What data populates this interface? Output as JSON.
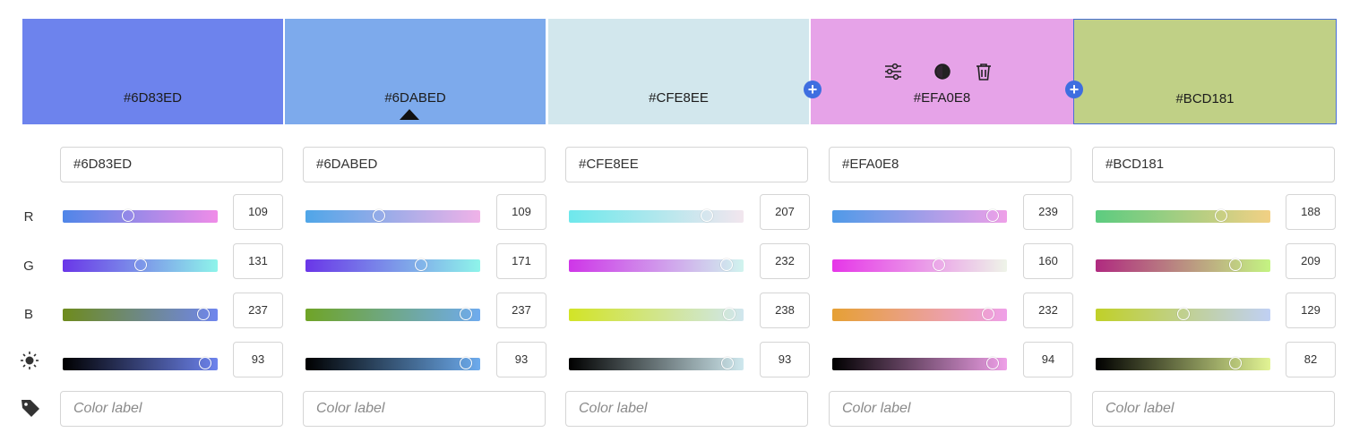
{
  "swatches": [
    {
      "hex": "#6D83ED",
      "color": "#6D83ED"
    },
    {
      "hex": "#6DABED",
      "color": "#7DAAEC"
    },
    {
      "hex": "#CFE8EE",
      "color": "#D2E7ED"
    },
    {
      "hex": "#EFA0E8",
      "color": "#E6A3E8"
    },
    {
      "hex": "#BCD181",
      "color": "#C0D086"
    }
  ],
  "selected_swatch": 4,
  "row_labels": {
    "r": "R",
    "g": "G",
    "b": "B"
  },
  "icons": {
    "add": "add-plus-icon",
    "adjust": "sliders-adjust-icon",
    "contrast": "contrast-icon",
    "delete": "trash-icon",
    "brightness": "brightness-sun-icon",
    "label": "tag-icon"
  },
  "columns": [
    {
      "hex_value": "#6D83ED",
      "label_placeholder": "Color label",
      "r": "109",
      "g": "131",
      "b": "237",
      "bright": "93",
      "r_pos": 0.42,
      "g_pos": 0.5,
      "b_pos": 0.91,
      "br_pos": 0.92,
      "r_grad": [
        "#4f86e8",
        "#f08ce8"
      ],
      "g_grad": [
        "#6a36e8",
        "#8ef4ea"
      ],
      "b_grad": [
        "#6e8b1c",
        "#6f86ee"
      ],
      "br_grad": [
        "#000000",
        "#6d83ed"
      ]
    },
    {
      "hex_value": "#6DABED",
      "label_placeholder": "Color label",
      "r": "109",
      "g": "171",
      "b": "237",
      "bright": "93",
      "r_pos": 0.42,
      "g_pos": 0.66,
      "b_pos": 0.92,
      "br_pos": 0.92,
      "r_grad": [
        "#4fa6e8",
        "#f0b2e8"
      ],
      "g_grad": [
        "#6a36e8",
        "#8ef4ea"
      ],
      "b_grad": [
        "#6fa426",
        "#6fabee"
      ],
      "br_grad": [
        "#000000",
        "#6dabed"
      ]
    },
    {
      "hex_value": "#CFE8EE",
      "label_placeholder": "Color label",
      "r": "207",
      "g": "232",
      "b": "238",
      "bright": "93",
      "r_pos": 0.79,
      "g_pos": 0.9,
      "b_pos": 0.92,
      "br_pos": 0.91,
      "r_grad": [
        "#6ee8ec",
        "#f2e6ee"
      ],
      "g_grad": [
        "#cf36e8",
        "#d0f4ee"
      ],
      "b_grad": [
        "#d2e426",
        "#d0e6ee"
      ],
      "br_grad": [
        "#000000",
        "#cfe8ee"
      ]
    },
    {
      "hex_value": "#EFA0E8",
      "label_placeholder": "Color label",
      "r": "239",
      "g": "160",
      "b": "232",
      "bright": "94",
      "r_pos": 0.92,
      "g_pos": 0.61,
      "b_pos": 0.89,
      "br_pos": 0.92,
      "r_grad": [
        "#4f9ae8",
        "#efa0e8"
      ],
      "g_grad": [
        "#e636e8",
        "#eef4e8"
      ],
      "b_grad": [
        "#e6a034",
        "#efa0e8"
      ],
      "br_grad": [
        "#000000",
        "#efa0e8"
      ]
    },
    {
      "hex_value": "#BCD181",
      "label_placeholder": "Color label",
      "r": "188",
      "g": "209",
      "b": "129",
      "bright": "82",
      "r_pos": 0.72,
      "g_pos": 0.8,
      "b_pos": 0.5,
      "br_pos": 0.8,
      "r_grad": [
        "#5ccc80",
        "#f2d084"
      ],
      "g_grad": [
        "#b02a80",
        "#c4f482"
      ],
      "b_grad": [
        "#c0d028",
        "#c0d0f4"
      ],
      "br_grad": [
        "#000000",
        "#e2f494"
      ]
    }
  ]
}
